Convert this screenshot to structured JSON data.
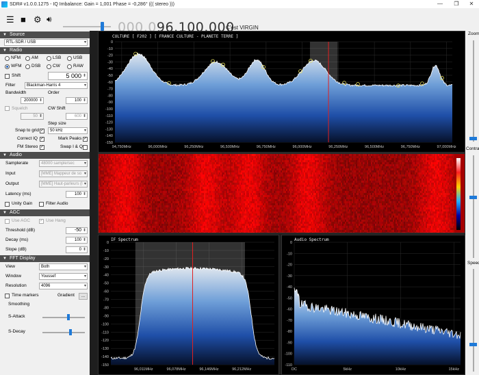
{
  "titlebar": {
    "title": "SDR# v1.0.0.1275 - IQ Imbalance: Gain = 1,001 Phase = -0,286° ((( stereo )))",
    "min": "—",
    "max": "❐",
    "close": "✕"
  },
  "toolbar": {
    "frequency_dim": "000.0",
    "frequency_main": "96.100.000",
    "station": "C'est VIRGIN"
  },
  "source": {
    "header": "Source",
    "device": "RTL-SDR / USB"
  },
  "radio": {
    "header": "Radio",
    "modes": [
      {
        "label": "NFM",
        "on": false
      },
      {
        "label": "AM",
        "on": false
      },
      {
        "label": "LSB",
        "on": false
      },
      {
        "label": "USB",
        "on": false
      },
      {
        "label": "WFM",
        "on": true
      },
      {
        "label": "DSB",
        "on": false
      },
      {
        "label": "CW",
        "on": false
      },
      {
        "label": "RAW",
        "on": false
      }
    ],
    "shift_label": "Shift",
    "shift_value": "5 000",
    "filter_label": "Filter",
    "filter_value": "Blackman-Harris 4",
    "bandwidth_label": "Bandwidth",
    "bandwidth_value": "200000",
    "order_label": "Order",
    "order_value": "100",
    "squelch_label": "Squelch",
    "squelch_value": "50",
    "cwshift_label": "CW Shift",
    "cwshift_value": "600",
    "stepsize_label": "Step size",
    "snap_label": "Snap to grid",
    "step_value": "50 kHz",
    "correctiq_label": "Correct IQ",
    "markpeaks_label": "Mark Peaks",
    "fmstereo_label": "FM Stereo",
    "swapiq_label": "Swap I & Q"
  },
  "audio": {
    "header": "Audio",
    "samplerate_label": "Samplerate",
    "samplerate_value": "48000 sample/sec",
    "input_label": "Input",
    "input_value": "[MME] Mappeur de so",
    "output_label": "Output",
    "output_value": "[MME] Haut-parleurs (I",
    "latency_label": "Latency (ms)",
    "latency_value": "100",
    "unity_label": "Unity Gain",
    "filteraudio_label": "Filter Audio"
  },
  "agc": {
    "header": "AGC",
    "useagc_label": "Use AGC",
    "usehang_label": "Use Hang",
    "threshold_label": "Threshold (dB)",
    "threshold_value": "-50",
    "decay_label": "Decay (ms)",
    "decay_value": "100",
    "slope_label": "Slope (dB)",
    "slope_value": "0"
  },
  "fft": {
    "header": "FFT Display",
    "view_label": "View",
    "view_value": "Both",
    "window_label": "Window",
    "window_value": "Youssef",
    "resolution_label": "Resolution",
    "resolution_value": "4096",
    "timemarkers_label": "Time markers",
    "gradient_label": "Gradient",
    "gradient_btn": "...",
    "smoothing_label": "Smoothing",
    "sattack_label": "S-Attack",
    "sdecay_label": "S-Decay"
  },
  "spectrum": {
    "title": "CULTURE [ F202 ]  [ FRANCE CULTURE - PLANETE TERRE ]",
    "y_ticks": [
      "0",
      "-10",
      "-20",
      "-30",
      "-40",
      "-50",
      "-60",
      "-70",
      "-80",
      "-90",
      "-100",
      "-110",
      "-120",
      "-130",
      "-140",
      "-150"
    ],
    "x_ticks": [
      "94,750MHz",
      "96,000MHz",
      "96,250MHz",
      "96,500MHz",
      "96,750MHz",
      "96,000MHz",
      "96,250MHz",
      "96,500MHz",
      "96,750MHz",
      "97,000MHz"
    ]
  },
  "if_spectrum": {
    "title": "IF Spectrum",
    "y_ticks": [
      "0",
      "-10",
      "-20",
      "-30",
      "-40",
      "-50",
      "-60",
      "-70",
      "-80",
      "-90",
      "-100",
      "-110",
      "-120",
      "-130",
      "-140",
      "-150"
    ],
    "x_ticks": [
      "96,011MHz",
      "96,078MHz",
      "96,146MHz",
      "96,212MHz"
    ]
  },
  "audio_spectrum": {
    "title": "Audio Spectrum",
    "y_ticks": [
      "0",
      "-10",
      "-20",
      "-30",
      "-40",
      "-50",
      "-60",
      "-70",
      "-80",
      "-90",
      "-100",
      "-110"
    ],
    "x_ticks": [
      "DC",
      "5kHz",
      "10kHz",
      "15kHz"
    ]
  },
  "right": {
    "zoom_label": "Zoom",
    "contrast_label": "Contra",
    "speed_label": "Speed"
  }
}
